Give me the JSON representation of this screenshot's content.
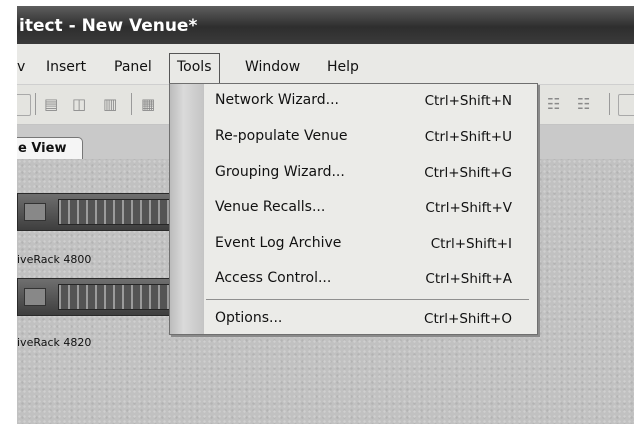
{
  "window": {
    "title": "itect - New Venue*"
  },
  "menubar": {
    "items": [
      {
        "label": "v"
      },
      {
        "label": "Insert"
      },
      {
        "label": "Panel"
      },
      {
        "label": "Tools"
      },
      {
        "label": "Window"
      },
      {
        "label": "Help"
      }
    ]
  },
  "toolbar": {
    "icons": [
      "toolbar-icon-1",
      "align-top-icon",
      "align-center-icon",
      "align-bottom-icon",
      "distribute-icon",
      "grid-a-icon",
      "grid-b-icon"
    ]
  },
  "tabs": [
    {
      "label": "e View"
    }
  ],
  "devices": [
    {
      "label": "iveRack 4800"
    },
    {
      "label": "iveRack 4820"
    }
  ],
  "tools_menu": {
    "items": [
      {
        "label": "Network Wizard...",
        "shortcut": "Ctrl+Shift+N"
      },
      {
        "label": "Re-populate Venue",
        "shortcut": "Ctrl+Shift+U"
      },
      {
        "label": "Grouping Wizard...",
        "shortcut": "Ctrl+Shift+G"
      },
      {
        "label": "Venue Recalls...",
        "shortcut": "Ctrl+Shift+V"
      },
      {
        "label": "Event Log Archive",
        "shortcut": "Ctrl+Shift+I"
      },
      {
        "label": "Access Control...",
        "shortcut": "Ctrl+Shift+A"
      },
      {
        "label": "Options...",
        "shortcut": "Ctrl+Shift+O"
      }
    ]
  }
}
